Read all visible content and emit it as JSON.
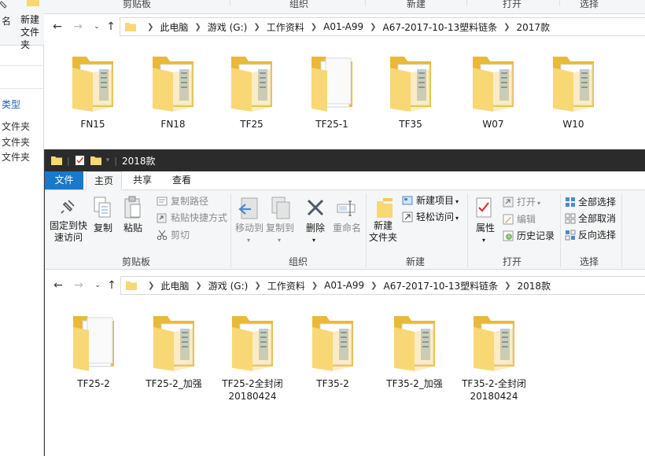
{
  "left_window": {
    "name_label": "名",
    "new_folder_label": "新建\n文件夹",
    "type_label": "类型",
    "items": [
      "文件夹",
      "文件夹",
      "文件夹"
    ]
  },
  "top_window": {
    "ribbon_groups": [
      "剪贴板",
      "组织",
      "新建",
      "打开",
      "选择"
    ],
    "breadcrumb": [
      "此电脑",
      "游戏 (G:)",
      "工作资料",
      "A01-A99",
      "A67-2017-10-13塑料链条",
      "2017款"
    ],
    "files": [
      {
        "name": "FN15",
        "icon": "folder-with-documents-icon"
      },
      {
        "name": "FN18",
        "icon": "folder-with-documents-icon"
      },
      {
        "name": "TF25",
        "icon": "folder-with-documents-icon"
      },
      {
        "name": "TF25-1",
        "icon": "folder-with-white-pages-icon"
      },
      {
        "name": "TF35",
        "icon": "folder-with-documents-icon"
      },
      {
        "name": "W07",
        "icon": "folder-with-documents-icon"
      },
      {
        "name": "W10",
        "icon": "folder-with-documents-icon"
      }
    ]
  },
  "lower_window": {
    "title": "2018款",
    "tabs": [
      "文件",
      "主页",
      "共享",
      "查看"
    ],
    "ribbon": {
      "clipboard": {
        "pin": "固定到快\n速访问",
        "copy": "复制",
        "paste": "粘贴",
        "copy_path": "复制路径",
        "paste_shortcut": "粘贴快捷方式",
        "cut": "剪切",
        "group": "剪贴板"
      },
      "organize": {
        "move_to": "移动到",
        "copy_to": "复制到",
        "delete": "删除",
        "rename": "重命名",
        "group": "组织"
      },
      "new": {
        "new_folder": "新建\n文件夹",
        "new_item": "新建项目",
        "easy_access": "轻松访问",
        "group": "新建"
      },
      "open": {
        "properties": "属性",
        "open": "打开",
        "edit": "编辑",
        "history": "历史记录",
        "group": "打开"
      },
      "select": {
        "select_all": "全部选择",
        "select_none": "全部取消",
        "invert": "反向选择",
        "group": "选择"
      }
    },
    "breadcrumb": [
      "此电脑",
      "游戏 (G:)",
      "工作资料",
      "A01-A99",
      "A67-2017-10-13塑料链条",
      "2018款"
    ],
    "files": [
      {
        "name": "TF25-2",
        "icon": "folder-with-white-pages-icon"
      },
      {
        "name": "TF25-2_加强",
        "icon": "folder-with-documents-icon"
      },
      {
        "name": "TF25-2全封闭\n20180424",
        "icon": "folder-with-documents-icon"
      },
      {
        "name": "TF35-2",
        "icon": "folder-with-documents-icon"
      },
      {
        "name": "TF35-2_加强",
        "icon": "folder-with-documents-icon"
      },
      {
        "name": "TF35-2-全封闭\n20180424",
        "icon": "folder-with-documents-icon"
      }
    ]
  },
  "colors": {
    "folder_yellow": "#f8d775",
    "folder_dark": "#e8b93a",
    "file_tab_blue": "#1979ca",
    "titlebar": "#2b2b2b"
  }
}
